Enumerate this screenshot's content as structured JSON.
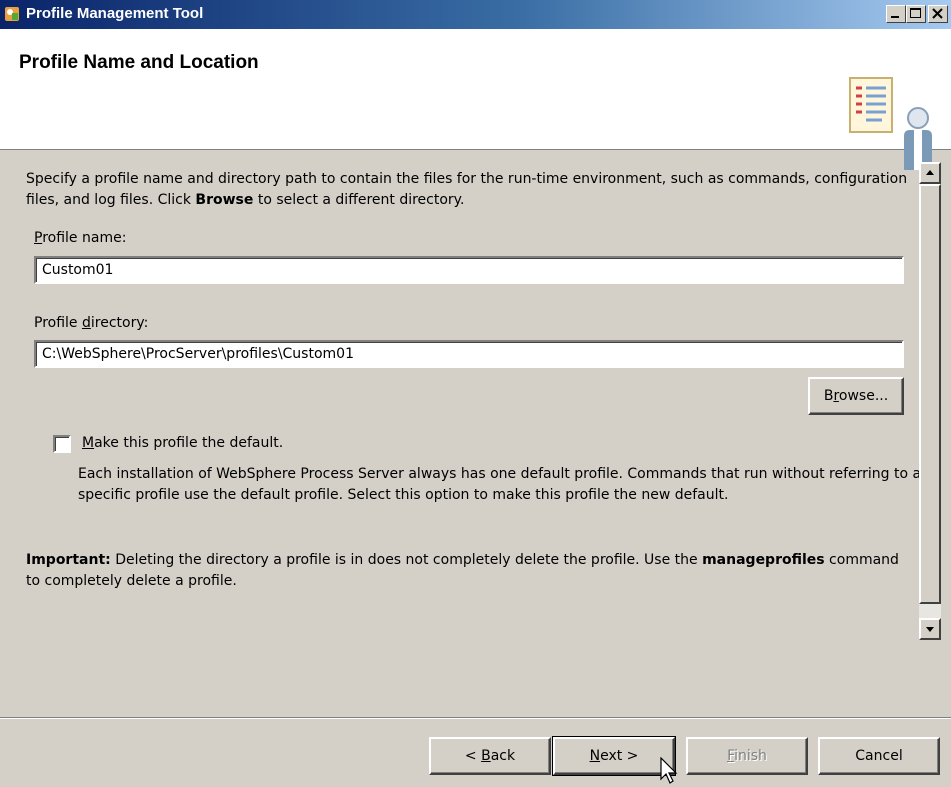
{
  "window": {
    "title": "Profile Management Tool"
  },
  "header": {
    "title": "Profile Name and Location"
  },
  "intro": {
    "text_before": "Specify a profile name and directory path to contain the files for the run-time environment, such as commands, configuration files, and log files. Click ",
    "bold": "Browse",
    "text_after": " to select a different directory."
  },
  "profile_name": {
    "label_mnemonic": "P",
    "label_rest": "rofile name:",
    "value": "Custom01"
  },
  "profile_directory": {
    "label_before": "Profile ",
    "label_mnemonic": "d",
    "label_rest": "irectory:",
    "value": "C:\\WebSphere\\ProcServer\\profiles\\Custom01"
  },
  "browse_button": {
    "before": "B",
    "mnemonic": "r",
    "after": "owse..."
  },
  "default_option": {
    "mnemonic": "M",
    "label_rest": "ake this profile the default.",
    "checked": false,
    "description": "Each installation of WebSphere Process Server always has one default profile. Commands that run without referring to a specific profile use the default profile. Select this option to make this profile the new default."
  },
  "important": {
    "bold_prefix": "Important:",
    "text_before": " Deleting the directory a profile is in does not completely delete the profile. Use the ",
    "bold_command": "manageprofiles",
    "text_after": " command to completely delete a profile."
  },
  "footer": {
    "back": {
      "prefix": "< ",
      "mnemonic": "B",
      "rest": "ack"
    },
    "next": {
      "mnemonic": "N",
      "rest": "ext >"
    },
    "finish": {
      "mnemonic": "F",
      "rest": "inish",
      "enabled": false
    },
    "cancel": "Cancel"
  },
  "icons": [
    "app-icon",
    "minimize-icon",
    "maximize-icon",
    "close-icon",
    "profile-wizard-icon",
    "scroll-up-icon",
    "scroll-down-icon",
    "mouse-pointer-icon"
  ],
  "colors": {
    "titlebar_start": "#0a246a",
    "titlebar_end": "#a6caf0",
    "dialog_bg": "#d4d0c8"
  }
}
